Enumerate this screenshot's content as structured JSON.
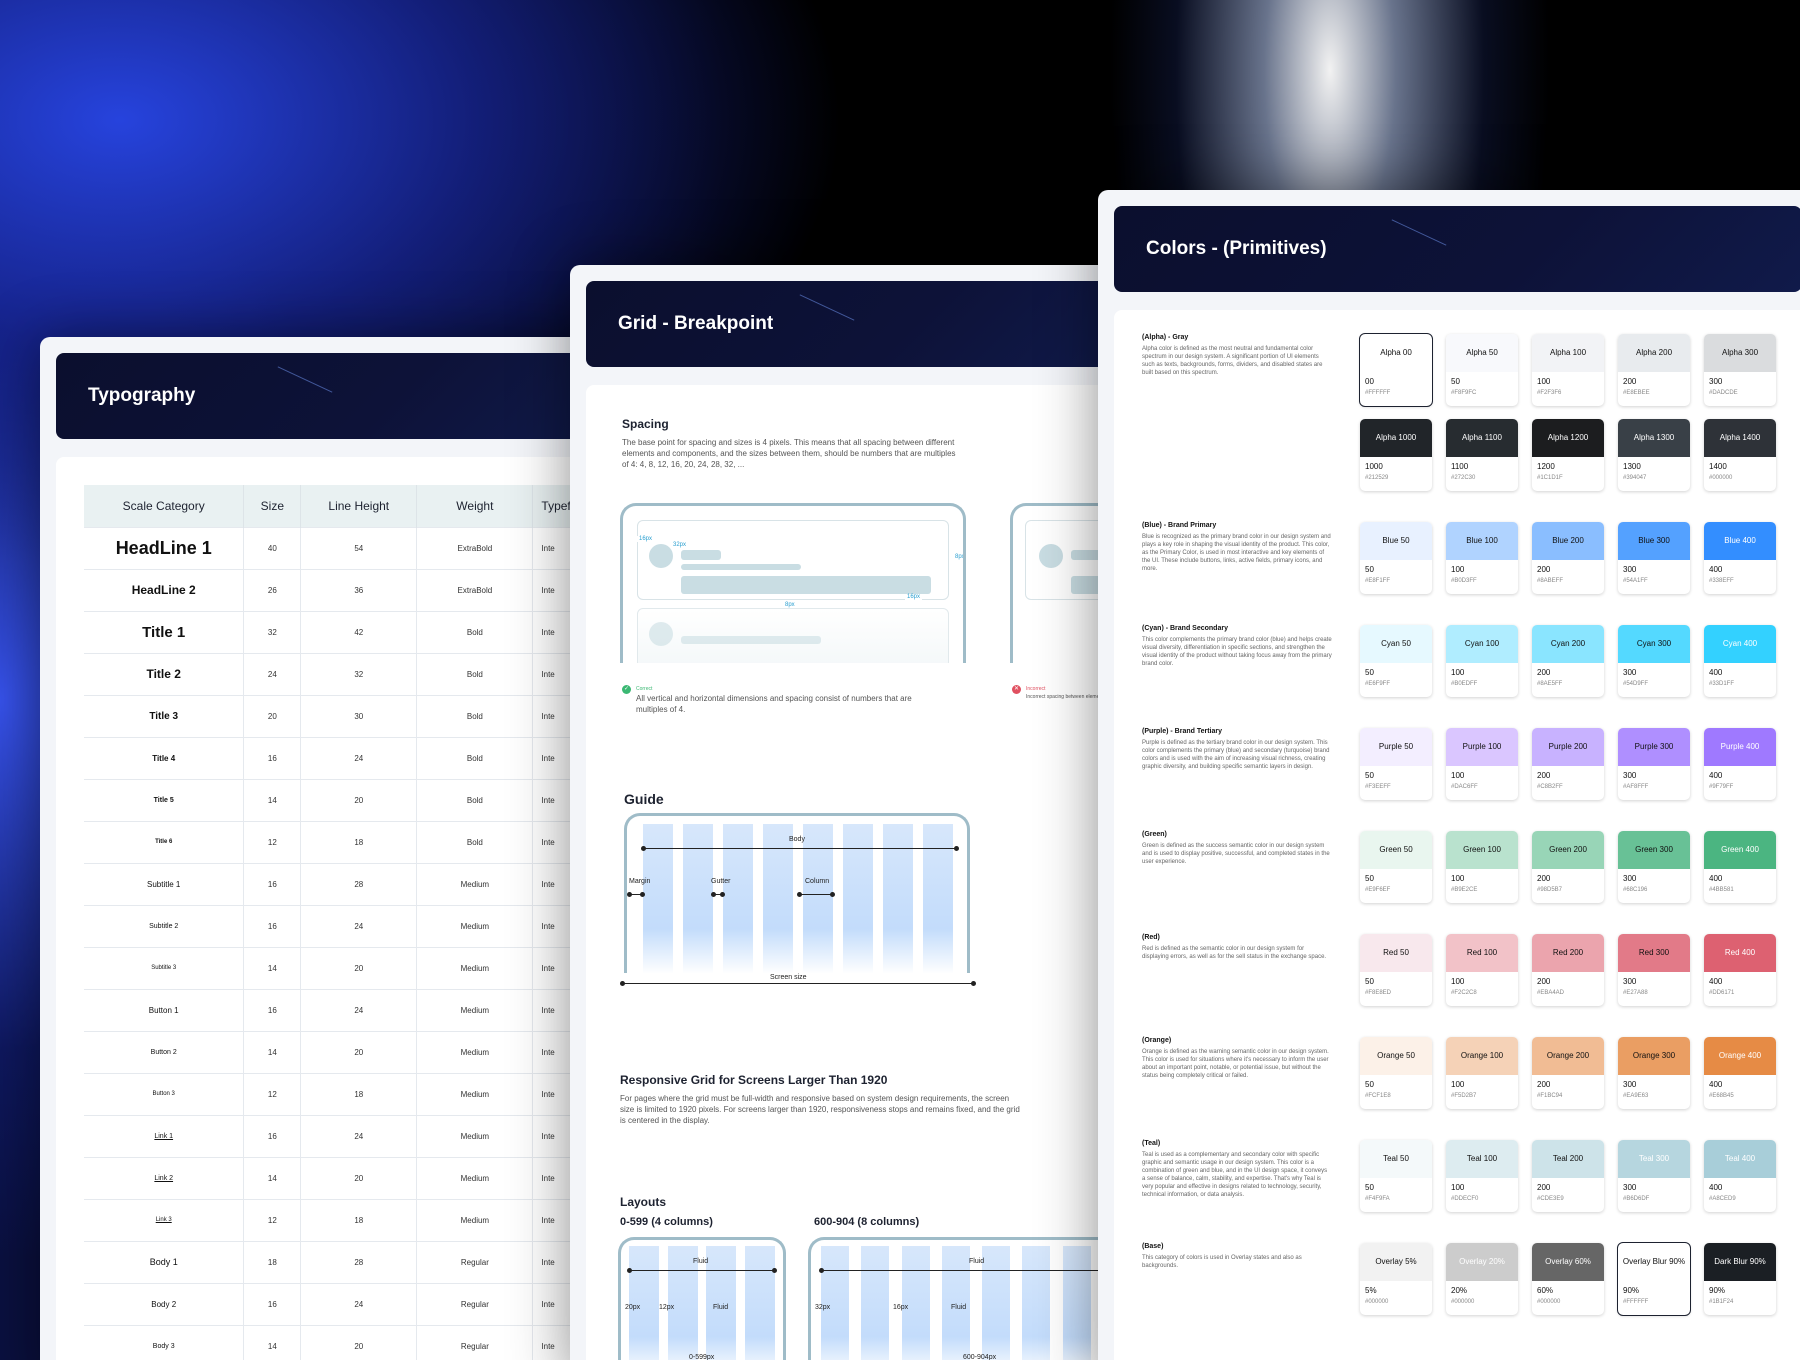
{
  "typography": {
    "title": "Typography",
    "headers": [
      "Scale Category",
      "Size",
      "Line Height",
      "Weight",
      "Typef"
    ],
    "rows": [
      [
        "HeadLine 1",
        "40",
        "54",
        "ExtraBold",
        "Inte"
      ],
      [
        "HeadLine 2",
        "26",
        "36",
        "ExtraBold",
        "Inte"
      ],
      [
        "Title 1",
        "32",
        "42",
        "Bold",
        "Inte"
      ],
      [
        "Title 2",
        "24",
        "32",
        "Bold",
        "Inte"
      ],
      [
        "Title 3",
        "20",
        "30",
        "Bold",
        "Inte"
      ],
      [
        "Title 4",
        "16",
        "24",
        "Bold",
        "Inte"
      ],
      [
        "Title 5",
        "14",
        "20",
        "Bold",
        "Inte"
      ],
      [
        "Title 6",
        "12",
        "18",
        "Bold",
        "Inte"
      ],
      [
        "Subtitle 1",
        "16",
        "28",
        "Medium",
        "Inte"
      ],
      [
        "Subtitle 2",
        "16",
        "24",
        "Medium",
        "Inte"
      ],
      [
        "Subtitle 3",
        "14",
        "20",
        "Medium",
        "Inte"
      ],
      [
        "Button 1",
        "16",
        "24",
        "Medium",
        "Inte"
      ],
      [
        "Button 2",
        "14",
        "20",
        "Medium",
        "Inte"
      ],
      [
        "Button 3",
        "12",
        "18",
        "Medium",
        "Inte"
      ],
      [
        "Link 1",
        "16",
        "24",
        "Medium",
        "Inte"
      ],
      [
        "Link 2",
        "14",
        "20",
        "Medium",
        "Inte"
      ],
      [
        "Link 3",
        "12",
        "18",
        "Medium",
        "Inte"
      ],
      [
        "Body 1",
        "18",
        "28",
        "Regular",
        "Inte"
      ],
      [
        "Body 2",
        "16",
        "24",
        "Regular",
        "Inte"
      ],
      [
        "Body 3",
        "14",
        "20",
        "Regular",
        "Inte"
      ]
    ]
  },
  "grid": {
    "title": "Grid - Breakpoint",
    "spacing_title": "Spacing",
    "spacing_text": "The base point for spacing and sizes is 4 pixels. This means that all spacing between different elements and components, and the sizes between them, should be numbers that are multiples of 4: 4, 8, 12, 16, 20, 24, 28, 32, ...",
    "correct_label": "Correct",
    "correct_text": "All vertical and horizontal dimensions and spacing consist of numbers that are multiples of 4.",
    "incorrect_label": "Incorrect",
    "incorrect_text": "Incorrect spacing between elements",
    "guide_title": "Guide",
    "guide_labels": {
      "body": "Body",
      "margin": "Margin",
      "gutter": "Gutter",
      "column": "Column",
      "screen": "Screen size"
    },
    "responsive_title": "Responsive Grid for Screens Larger Than 1920",
    "responsive_text": "For pages where the grid must be full-width and responsive based on system design requirements, the screen size is limited to 1920 pixels. For screens larger than 1920, responsiveness stops and remains fixed, and the grid is centered in the display.",
    "layouts_title": "Layouts",
    "layout1": "0-599 (4 columns)",
    "layout2": "600-904 (8 columns)",
    "l1": {
      "fluid": "Fluid",
      "a": "20px",
      "b": "12px",
      "c": "Fluid",
      "range": "0-599px"
    },
    "l2": {
      "fluid": "Fluid",
      "a": "32px",
      "b": "16px",
      "c": "Fluid",
      "range": "600-904px"
    },
    "spacing_marks": [
      "16px",
      "32px",
      "8px",
      "16px",
      "8px"
    ]
  },
  "colors": {
    "title": "Colors - (Primitives)",
    "groups": [
      {
        "name": "(Alpha) - Gray",
        "desc": "Alpha color is defined as the most neutral and fundamental color spectrum in our design system. A significant portion of UI elements such as texts, backgrounds, forms, dividers, and disabled states are built based on this spectrum.",
        "swatches": [
          {
            "label": "Alpha 00",
            "num": "00",
            "hex": "#FFFFFF",
            "bg": "#ffffff",
            "fg": "#111"
          },
          {
            "label": "Alpha 50",
            "num": "50",
            "hex": "#F8F9FC",
            "bg": "#f8f9fc",
            "fg": "#111"
          },
          {
            "label": "Alpha 100",
            "num": "100",
            "hex": "#F2F3F6",
            "bg": "#f2f3f6",
            "fg": "#111"
          },
          {
            "label": "Alpha 200",
            "num": "200",
            "hex": "#E8EBEE",
            "bg": "#e8ebee",
            "fg": "#111"
          },
          {
            "label": "Alpha 300",
            "num": "300",
            "hex": "#DADCDE",
            "bg": "#dadcde",
            "fg": "#111"
          }
        ],
        "swatches2": [
          {
            "label": "Alpha 1000",
            "num": "1000",
            "hex": "#212529",
            "bg": "#212529",
            "fg": "#fff"
          },
          {
            "label": "Alpha 1100",
            "num": "1100",
            "hex": "#272C30",
            "bg": "#272c30",
            "fg": "#fff"
          },
          {
            "label": "Alpha 1200",
            "num": "1200",
            "hex": "#1C1D1F",
            "bg": "#1c1d1f",
            "fg": "#fff"
          },
          {
            "label": "Alpha 1300",
            "num": "1300",
            "hex": "#394047",
            "bg": "#394047",
            "fg": "#fff"
          },
          {
            "label": "Alpha 1400",
            "num": "1400",
            "hex": "#000000",
            "bg": "#2e3238",
            "fg": "#fff"
          }
        ]
      },
      {
        "name": "(Blue) - Brand Primary",
        "desc": "Blue is recognized as the primary brand color in our design system and plays a key role in shaping the visual identity of the product. This color, as the Primary Color, is used in most interactive and key elements of the UI. These include buttons, links, active fields, primary icons, and more.",
        "swatches": [
          {
            "label": "Blue 50",
            "num": "50",
            "hex": "#E8F1FF",
            "bg": "#e8f1ff",
            "fg": "#111"
          },
          {
            "label": "Blue 100",
            "num": "100",
            "hex": "#B0D3FF",
            "bg": "#b0d3ff",
            "fg": "#111"
          },
          {
            "label": "Blue 200",
            "num": "200",
            "hex": "#8ABEFF",
            "bg": "#8abeff",
            "fg": "#111"
          },
          {
            "label": "Blue 300",
            "num": "300",
            "hex": "#54A1FF",
            "bg": "#54a1ff",
            "fg": "#111"
          },
          {
            "label": "Blue 400",
            "num": "400",
            "hex": "#338EFF",
            "bg": "#338eff",
            "fg": "#fff"
          }
        ]
      },
      {
        "name": "(Cyan) - Brand Secondary",
        "desc": "This color complements the primary brand color (blue) and helps create visual diversity, differentiation in specific sections, and strengthen the visual identity of the product without taking focus away from the primary brand color.",
        "swatches": [
          {
            "label": "Cyan 50",
            "num": "50",
            "hex": "#E6F9FF",
            "bg": "#e6f9ff",
            "fg": "#111"
          },
          {
            "label": "Cyan 100",
            "num": "100",
            "hex": "#B0EDFF",
            "bg": "#b0edff",
            "fg": "#111"
          },
          {
            "label": "Cyan 200",
            "num": "200",
            "hex": "#8AE5FF",
            "bg": "#8ae5ff",
            "fg": "#111"
          },
          {
            "label": "Cyan 300",
            "num": "300",
            "hex": "#54D9FF",
            "bg": "#54d9ff",
            "fg": "#111"
          },
          {
            "label": "Cyan 400",
            "num": "400",
            "hex": "#33D1FF",
            "bg": "#33d1ff",
            "fg": "#fff"
          }
        ]
      },
      {
        "name": "(Purple) - Brand Tertiary",
        "desc": "Purple is defined as the tertiary brand color in our design system. This color complements the primary (blue) and secondary (turquoise) brand colors and is used with the aim of increasing visual richness, creating graphic diversity, and building specific semantic layers in design.",
        "swatches": [
          {
            "label": "Purple 50",
            "num": "50",
            "hex": "#F3EEFF",
            "bg": "#f3eeff",
            "fg": "#111"
          },
          {
            "label": "Purple 100",
            "num": "100",
            "hex": "#DAC6FF",
            "bg": "#dac6ff",
            "fg": "#111"
          },
          {
            "label": "Purple 200",
            "num": "200",
            "hex": "#C8B2FF",
            "bg": "#c8b2ff",
            "fg": "#111"
          },
          {
            "label": "Purple 300",
            "num": "300",
            "hex": "#AF8FFF",
            "bg": "#af8fff",
            "fg": "#111"
          },
          {
            "label": "Purple 400",
            "num": "400",
            "hex": "#9F79FF",
            "bg": "#9f79ff",
            "fg": "#fff"
          }
        ]
      },
      {
        "name": "(Green)",
        "desc": "Green is defined as the success semantic color in our design system and is used to display positive, successful, and completed states in the user experience.",
        "swatches": [
          {
            "label": "Green 50",
            "num": "50",
            "hex": "#E9F6EF",
            "bg": "#e9f6ef",
            "fg": "#111"
          },
          {
            "label": "Green 100",
            "num": "100",
            "hex": "#B9E2CE",
            "bg": "#b9e2ce",
            "fg": "#111"
          },
          {
            "label": "Green 200",
            "num": "200",
            "hex": "#98D5B7",
            "bg": "#98d5b7",
            "fg": "#111"
          },
          {
            "label": "Green 300",
            "num": "300",
            "hex": "#68C196",
            "bg": "#68c196",
            "fg": "#111"
          },
          {
            "label": "Green 400",
            "num": "400",
            "hex": "#4BB581",
            "bg": "#4bb581",
            "fg": "#fff"
          }
        ]
      },
      {
        "name": "(Red)",
        "desc": "Red is defined as the semantic color in our design system for displaying errors, as well as for the sell status in the exchange space.",
        "swatches": [
          {
            "label": "Red 50",
            "num": "50",
            "hex": "#F8E8ED",
            "bg": "#f8e8ed",
            "fg": "#111"
          },
          {
            "label": "Red 100",
            "num": "100",
            "hex": "#F2C2C8",
            "bg": "#f2c2c8",
            "fg": "#111"
          },
          {
            "label": "Red 200",
            "num": "200",
            "hex": "#EBA4AD",
            "bg": "#eba4ad",
            "fg": "#111"
          },
          {
            "label": "Red 300",
            "num": "300",
            "hex": "#E27A88",
            "bg": "#e27a88",
            "fg": "#111"
          },
          {
            "label": "Red 400",
            "num": "400",
            "hex": "#DD6171",
            "bg": "#dd6171",
            "fg": "#fff"
          }
        ]
      },
      {
        "name": "(Orange)",
        "desc": "Orange is defined as the warning semantic color in our design system. This color is used for situations where it's necessary to inform the user about an important point, notable, or potential issue, but without the status being completely critical or failed.",
        "swatches": [
          {
            "label": "Orange 50",
            "num": "50",
            "hex": "#FCF1E8",
            "bg": "#fcf1e8",
            "fg": "#111"
          },
          {
            "label": "Orange 100",
            "num": "100",
            "hex": "#F5D2B7",
            "bg": "#f5d2b7",
            "fg": "#111"
          },
          {
            "label": "Orange 200",
            "num": "200",
            "hex": "#F1BC94",
            "bg": "#f1bc94",
            "fg": "#111"
          },
          {
            "label": "Orange 300",
            "num": "300",
            "hex": "#EA9E63",
            "bg": "#ea9e63",
            "fg": "#111"
          },
          {
            "label": "Orange 400",
            "num": "400",
            "hex": "#E68B45",
            "bg": "#e68b45",
            "fg": "#fff"
          }
        ]
      },
      {
        "name": "(Teal)",
        "desc": "Teal is used as a complementary and secondary color with specific graphic and semantic usage in our design system. This color is a combination of green and blue, and in the UI design space, it conveys a sense of balance, calm, stability, and expertise. That's why Teal is very popular and effective in designs related to technology, security, technical information, or data analysis.",
        "swatches": [
          {
            "label": "Teal 50",
            "num": "50",
            "hex": "#F4F9FA",
            "bg": "#f4f9fa",
            "fg": "#111"
          },
          {
            "label": "Teal 100",
            "num": "100",
            "hex": "#DDECF0",
            "bg": "#ddecf0",
            "fg": "#111"
          },
          {
            "label": "Teal 200",
            "num": "200",
            "hex": "#CDE3E9",
            "bg": "#cde3e9",
            "fg": "#111"
          },
          {
            "label": "Teal 300",
            "num": "300",
            "hex": "#B6D6DF",
            "bg": "#b6d6df",
            "fg": "#fff"
          },
          {
            "label": "Teal 400",
            "num": "400",
            "hex": "#A8CED9",
            "bg": "#a8ced9",
            "fg": "#fff"
          }
        ]
      },
      {
        "name": "(Base)",
        "desc": "This category of colors is used in Overlay states and also as backgrounds.",
        "swatches": [
          {
            "label": "Overlay 5%",
            "num": "5%",
            "hex": "#000000",
            "bg": "#f2f2f2",
            "fg": "#111"
          },
          {
            "label": "Overlay 20%",
            "num": "20%",
            "hex": "#000000",
            "bg": "#cccccc",
            "fg": "#fff"
          },
          {
            "label": "Overlay 60%",
            "num": "60%",
            "hex": "#000000",
            "bg": "#666666",
            "fg": "#fff"
          },
          {
            "label": "Overlay Blur 90%",
            "num": "90%",
            "hex": "#FFFFFF",
            "bg": "#ffffff",
            "fg": "#111"
          },
          {
            "label": "Dark Blur 90%",
            "num": "90%",
            "hex": "#1B1F24",
            "bg": "#1b1f24",
            "fg": "#fff"
          }
        ]
      }
    ]
  }
}
